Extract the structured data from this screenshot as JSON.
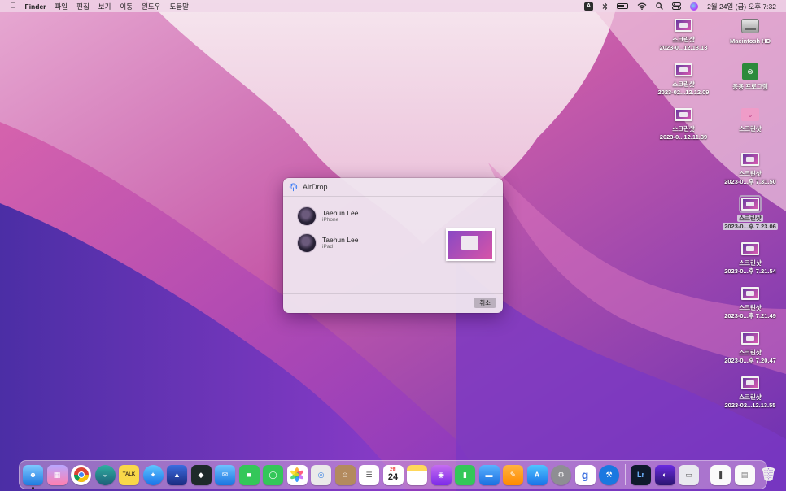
{
  "menubar": {
    "app_name": "Finder",
    "menus": [
      "파일",
      "편집",
      "보기",
      "이동",
      "윈도우",
      "도움말"
    ],
    "input_source": "A",
    "datetime": "2월 24일 (금) 오후 7:32"
  },
  "desktop": {
    "column_left": [
      {
        "line1": "스크린샷",
        "line2": "2023-0...12.13.13"
      },
      {
        "line1": "스크린샷",
        "line2": "2023-02...12.12.09"
      },
      {
        "line1": "스크린샷",
        "line2": "2023-0...12.11.39"
      }
    ],
    "column_right": [
      {
        "line1": "Macintosh HD",
        "line2": ""
      },
      {
        "line1": "응용 프로그램",
        "line2": ""
      },
      {
        "line1": "스크린샷",
        "line2": ""
      },
      {
        "line1": "스크린샷",
        "line2": "2023-0...후 7.31.50"
      },
      {
        "line1": "스크린샷",
        "line2": "2023-0...후 7.23.06"
      },
      {
        "line1": "스크린샷",
        "line2": "2023-0...후 7.21.54"
      },
      {
        "line1": "스크린샷",
        "line2": "2023-0...후 7.21.49"
      },
      {
        "line1": "스크린샷",
        "line2": "2023-0...후 7.20.47"
      },
      {
        "line1": "스크린샷",
        "line2": "2023-02...12.13.55"
      }
    ]
  },
  "airdrop": {
    "title": "AirDrop",
    "recipients": [
      {
        "name": "Taehun Lee",
        "device": "iPhone"
      },
      {
        "name": "Taehun Lee",
        "device": "iPad"
      }
    ],
    "cancel_label": "취소"
  },
  "dock": {
    "calendar_month": "2월",
    "calendar_day": "24",
    "talk_label": "TALK",
    "lightroom_label": "Lr",
    "grammarly_label": "g",
    "xbox_glyph": "⊗"
  },
  "colors": {
    "accent": "#3478f6",
    "wallpaper_top": "#f3b8cf",
    "wallpaper_bottom": "#5a2fb0"
  }
}
